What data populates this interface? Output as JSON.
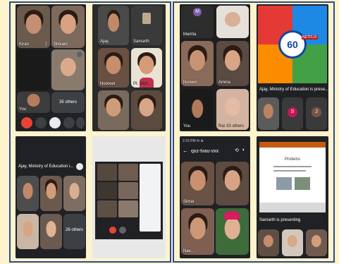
{
  "colors": {
    "frame": "#2e4a92",
    "background": "#fdf3cc",
    "meet_dark": "#202124",
    "end_call_red": "#ea4335"
  },
  "s1": {
    "t_kiran": "Kiran",
    "t_shivani": "Shivani",
    "t_you": "You",
    "others": "35 others"
  },
  "s2": {
    "t_ajay": "Ajay,",
    "t_samarth": "Samarth",
    "t_nooreet": "Nooreet",
    "t_pt": "Pt. Moh.."
  },
  "s3": {
    "t_mamta": "Mamta",
    "t_m_initial": "M",
    "t_noreen": "Noreen",
    "t_amina": "Amina",
    "t_you": "You",
    "t_rai": "Rai",
    "others": "33 others"
  },
  "s4": {
    "presenter": "Ajay, Ministry of Education is prese...",
    "center_number": "60",
    "netflix": "NETFLIX",
    "s_initial": "S",
    "j_initial": "J"
  },
  "s5": {
    "title": "Ajay, Ministry of Education i...",
    "others": "26 others"
  },
  "s7": {
    "status": "2:16 PM  ✉ ⊕",
    "meeting_code": "qxz-tvau-vxx",
    "t_simar": "Simar",
    "t_nav": "Nav..."
  },
  "s8": {
    "slide_heading": "Proteins",
    "presenting": "Samarth is presenting"
  }
}
